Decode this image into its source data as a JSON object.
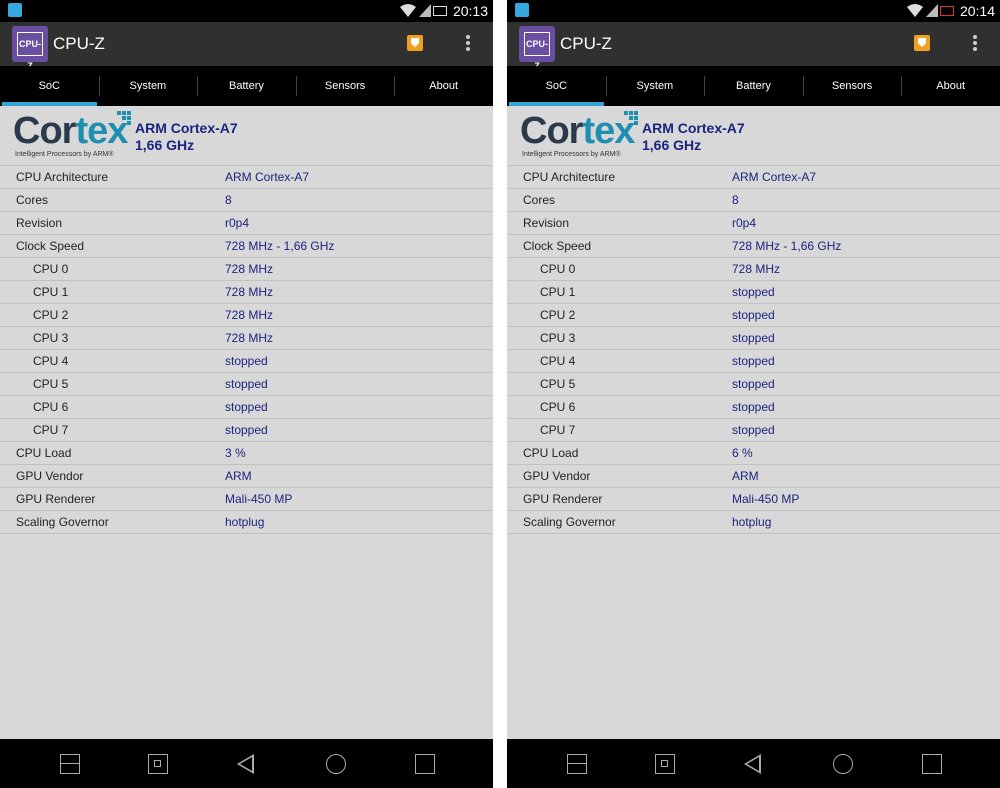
{
  "screens": [
    {
      "status_time": "20:13",
      "battery_state": "normal",
      "rows": [
        {
          "label": "CPU Architecture",
          "value": "ARM Cortex-A7"
        },
        {
          "label": "Cores",
          "value": "8"
        },
        {
          "label": "Revision",
          "value": "r0p4"
        },
        {
          "label": "Clock Speed",
          "value": "728 MHz - 1,66 GHz"
        },
        {
          "label": "CPU 0",
          "value": "728 MHz"
        },
        {
          "label": "CPU 1",
          "value": "728 MHz"
        },
        {
          "label": "CPU 2",
          "value": "728 MHz"
        },
        {
          "label": "CPU 3",
          "value": "728 MHz"
        },
        {
          "label": "CPU 4",
          "value": "stopped"
        },
        {
          "label": "CPU 5",
          "value": "stopped"
        },
        {
          "label": "CPU 6",
          "value": "stopped"
        },
        {
          "label": "CPU 7",
          "value": "stopped"
        },
        {
          "label": "CPU Load",
          "value": "3 %"
        },
        {
          "label": "GPU Vendor",
          "value": "ARM"
        },
        {
          "label": "GPU Renderer",
          "value": "Mali-450 MP"
        },
        {
          "label": "Scaling Governor",
          "value": "hotplug"
        }
      ]
    },
    {
      "status_time": "20:14",
      "battery_state": "low",
      "rows": [
        {
          "label": "CPU Architecture",
          "value": "ARM Cortex-A7"
        },
        {
          "label": "Cores",
          "value": "8"
        },
        {
          "label": "Revision",
          "value": "r0p4"
        },
        {
          "label": "Clock Speed",
          "value": "728 MHz - 1,66 GHz"
        },
        {
          "label": "CPU 0",
          "value": "728 MHz"
        },
        {
          "label": "CPU 1",
          "value": "stopped"
        },
        {
          "label": "CPU 2",
          "value": "stopped"
        },
        {
          "label": "CPU 3",
          "value": "stopped"
        },
        {
          "label": "CPU 4",
          "value": "stopped"
        },
        {
          "label": "CPU 5",
          "value": "stopped"
        },
        {
          "label": "CPU 6",
          "value": "stopped"
        },
        {
          "label": "CPU 7",
          "value": "stopped"
        },
        {
          "label": "CPU Load",
          "value": "6 %"
        },
        {
          "label": "GPU Vendor",
          "value": "ARM"
        },
        {
          "label": "GPU Renderer",
          "value": "Mali-450 MP"
        },
        {
          "label": "Scaling Governor",
          "value": "hotplug"
        }
      ]
    }
  ],
  "app": {
    "title": "CPU-Z",
    "icon_label": "CPU-Z",
    "tabs": [
      "SoC",
      "System",
      "Battery",
      "Sensors",
      "About"
    ],
    "active_tab": "SoC"
  },
  "soc": {
    "logo_word_prefix": "Cor",
    "logo_word_suffix": "tex",
    "logo_tagline": "Intelligent Processors by ARM®",
    "cpu_name": "ARM Cortex-A7",
    "cpu_freq": "1,66 GHz"
  },
  "icons": {
    "status": [
      "notification-icon",
      "wifi-icon",
      "signal-icon",
      "battery-icon"
    ],
    "appbar": [
      "app-icon",
      "share-icon",
      "overflow-menu-icon"
    ],
    "nav": [
      "split-screen-icon",
      "screenshot-icon",
      "back-icon",
      "home-icon",
      "recent-apps-icon"
    ]
  },
  "colors": {
    "accent": "#33a6d8",
    "value_text": "#1a237e",
    "app_icon_bg": "#6a4fa0",
    "share_icon": "#f0a020",
    "battery_low": "#dd3333"
  }
}
